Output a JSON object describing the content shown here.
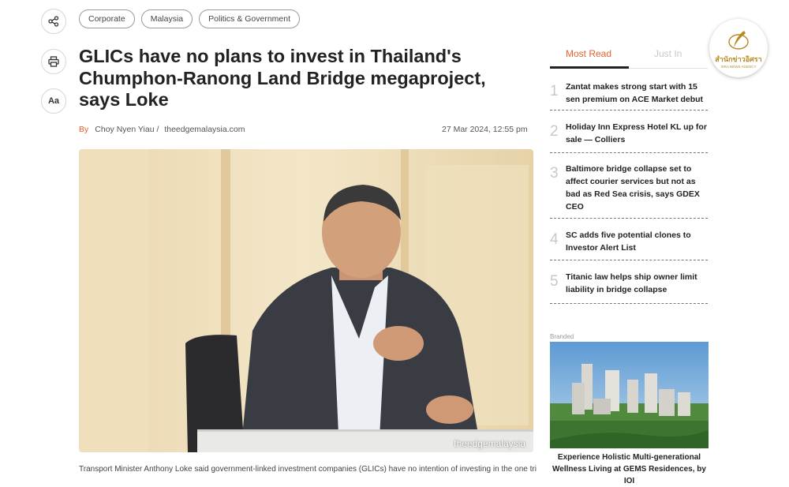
{
  "tags": [
    "Corporate",
    "Malaysia",
    "Politics & Government"
  ],
  "side_buttons": {
    "text_size_label": "Aa"
  },
  "article": {
    "title": "GLICs have no plans to invest in Thailand's Chumphon-Ranong Land Bridge megaproject, says Loke",
    "by_label": "By",
    "author": "Choy Nyen Yiau /",
    "source": "theedgemalaysia.com",
    "date": "27 Mar 2024, 12:55 pm",
    "image_caption": "theedgemalaysia",
    "lede": "Transport Minister Anthony Loke said government-linked investment companies (GLICs) have no intention of investing in the one trillion"
  },
  "sidebar": {
    "tabs": [
      "Most Read",
      "Just In"
    ],
    "most_read": [
      {
        "num": "1",
        "title": "Zantat makes strong start with 15 sen premium on ACE Market debut"
      },
      {
        "num": "2",
        "title": "Holiday Inn Express Hotel KL up for sale — Colliers"
      },
      {
        "num": "3",
        "title": "Baltimore bridge collapse set to affect courier services but not as bad as Red Sea crisis, says GDEX CEO"
      },
      {
        "num": "4",
        "title": "SC adds five potential clones to Investor Alert List"
      },
      {
        "num": "5",
        "title": "Titanic law helps ship owner limit liability in bridge collapse"
      }
    ],
    "branded_label": "Branded",
    "ad_title": "Experience Holistic Multi-generational Wellness Living at GEMS Residences, by IOI"
  },
  "logo": {
    "thai": "สำนักข่าวอิศรา",
    "english": "ISRA NEWS AGENCY"
  },
  "colors": {
    "accent": "#e8622c",
    "muted": "#c8c8c8",
    "gold": "#b98a22"
  }
}
